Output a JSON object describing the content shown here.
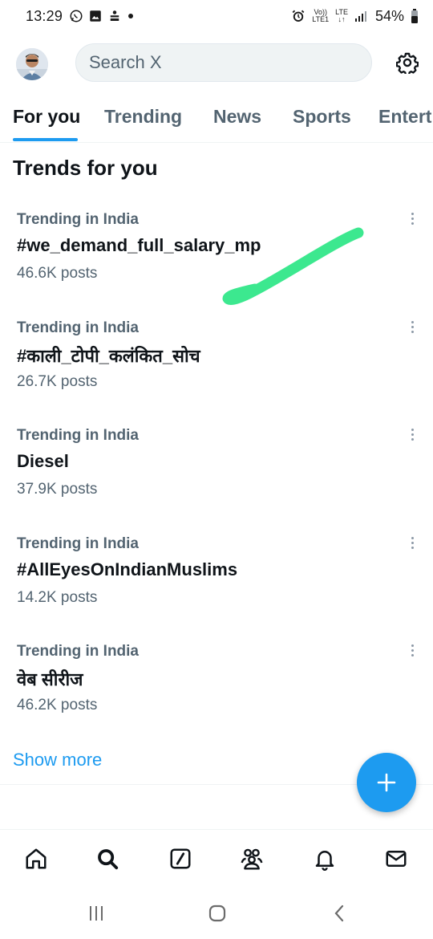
{
  "status_bar": {
    "time": "13:29",
    "network_top": "Vo))",
    "network_bottom": "LTE1",
    "lte_top": "LTE",
    "lte_bottom": "↓↑",
    "battery": "54%"
  },
  "header": {
    "search_placeholder": "Search X",
    "avatar_icon": "profile-avatar",
    "settings_icon": "gear-icon"
  },
  "tabs": [
    {
      "label": "For you",
      "active": true
    },
    {
      "label": "Trending",
      "active": false
    },
    {
      "label": "News",
      "active": false
    },
    {
      "label": "Sports",
      "active": false
    },
    {
      "label": "Entert",
      "active": false
    }
  ],
  "section_title": "Trends for you",
  "trends": [
    {
      "context": "Trending in India",
      "name": "#we_demand_full_salary_mp",
      "count": "46.6K posts"
    },
    {
      "context": "Trending in India",
      "name": "#काली_टोपी_कलंकित_सोच",
      "count": "26.7K posts"
    },
    {
      "context": "Trending in India",
      "name": "Diesel",
      "count": "37.9K posts"
    },
    {
      "context": "Trending in India",
      "name": "#AllEyesOnIndianMuslims",
      "count": "14.2K posts"
    },
    {
      "context": "Trending in India",
      "name": "वेब सीरीज",
      "count": "46.2K posts"
    }
  ],
  "show_more": "Show more",
  "colors": {
    "accent": "#1d9bf0",
    "annotation_stroke": "#3ce88f",
    "secondary_text": "#536471"
  },
  "bottom_nav": [
    "home-icon",
    "search-icon",
    "grok-icon",
    "communities-icon",
    "notifications-icon",
    "messages-icon"
  ],
  "android_nav": [
    "recents-icon",
    "home-icon",
    "back-icon"
  ]
}
